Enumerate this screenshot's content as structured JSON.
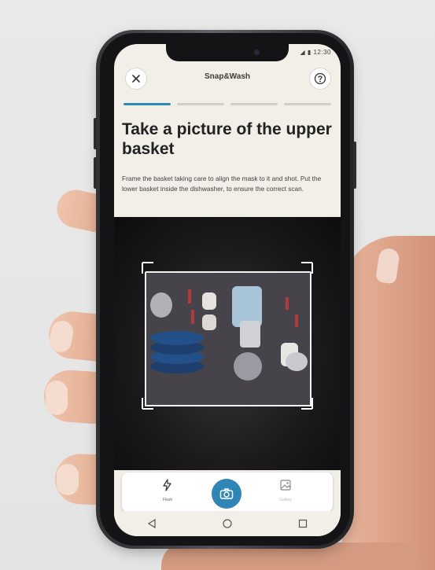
{
  "status_bar": {
    "time": "12:30"
  },
  "header": {
    "title": "Snap&Wash"
  },
  "progress": {
    "total_steps": 4,
    "current_step": 1
  },
  "instruction": {
    "title": "Take a picture of the upper basket",
    "description": "Frame the basket taking care to align the mask to it and shot. Put the lower basket inside the dishwasher, to ensure the correct scan."
  },
  "camera_bar": {
    "flash_label": "Flash",
    "gallery_label": "Gallery"
  },
  "colors": {
    "accent": "#2f86b4",
    "screen_bg": "#f2efe9"
  },
  "icons": {
    "close": "close-icon",
    "help": "question-icon",
    "flash": "flash-auto-icon",
    "shutter": "camera-icon",
    "gallery": "image-icon",
    "back": "triangle-back-icon",
    "home": "circle-home-icon",
    "recents": "square-recents-icon"
  }
}
